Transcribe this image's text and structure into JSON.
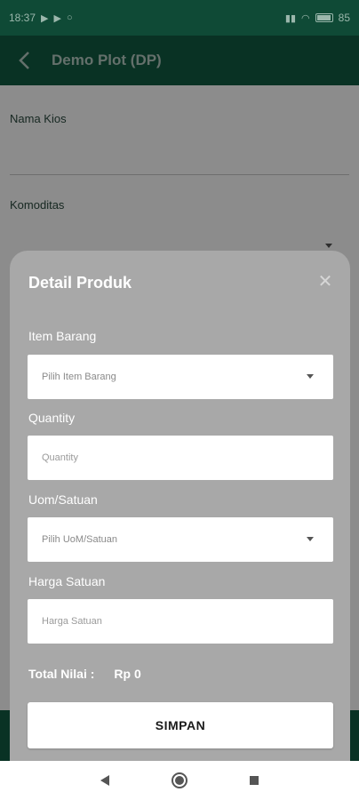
{
  "status_bar": {
    "time": "18:37",
    "battery": "85"
  },
  "app_bar": {
    "title": "Demo Plot (DP)"
  },
  "page": {
    "nama_kios_label": "Nama Kios",
    "komoditas_label": "Komoditas"
  },
  "sheet": {
    "title": "Detail Produk",
    "item_barang": {
      "label": "Item Barang",
      "placeholder": "Pilih Item Barang"
    },
    "quantity": {
      "label": "Quantity",
      "placeholder": "Quantity"
    },
    "uom": {
      "label": "Uom/Satuan",
      "placeholder": "Pilih UoM/Satuan"
    },
    "harga_satuan": {
      "label": "Harga Satuan",
      "placeholder": "Harga Satuan"
    },
    "total_label": "Total Nilai :",
    "total_value": "Rp 0",
    "save_label": "SIMPAN"
  },
  "colors": {
    "status_bar": "#0f4a36",
    "app_bar": "#125c43",
    "sheet": "#a8a8a8"
  },
  "icons": {
    "back": "arrow-left-icon",
    "close": "close-icon",
    "dropdown": "caret-down-icon",
    "nav_back": "triangle-back-icon",
    "nav_home": "circle-home-icon",
    "nav_recent": "square-recent-icon"
  }
}
